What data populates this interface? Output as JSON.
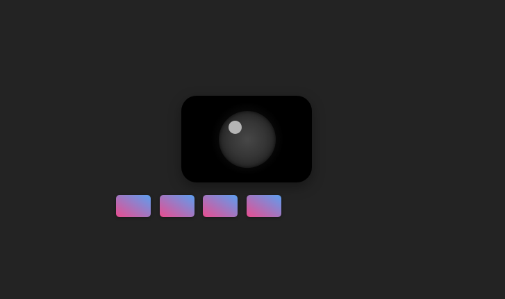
{
  "colors": {
    "background": "#232323",
    "camera_body": "#000000",
    "lens": "#3a3a3a",
    "lens_highlight": "#b5b5b5",
    "gradient_start": "#e94d8f",
    "gradient_end": "#5c9ff0"
  },
  "icons": {
    "camera": "camera-icon",
    "lens": "camera-lens-icon"
  },
  "swatches": [
    {
      "from": "#e94d8f",
      "to": "#5c9ff0"
    },
    {
      "from": "#e94d8f",
      "to": "#5c9ff0"
    },
    {
      "from": "#e94d8f",
      "to": "#5c9ff0"
    },
    {
      "from": "#e94d8f",
      "to": "#5c9ff0"
    }
  ]
}
